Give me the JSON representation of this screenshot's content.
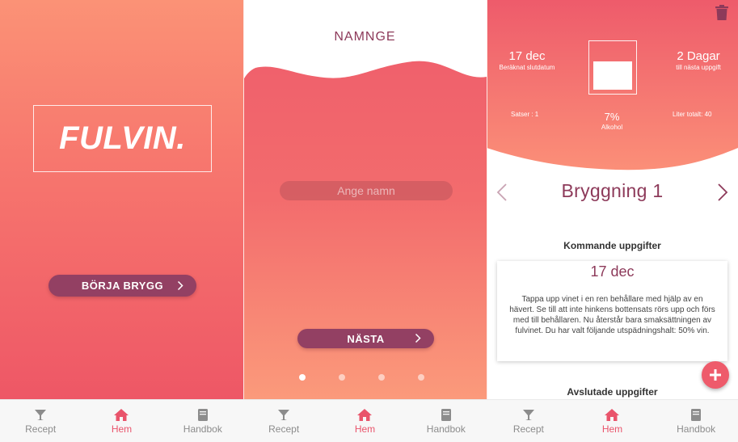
{
  "colors": {
    "accent": "#ee5b6b",
    "coral": "#fb9276",
    "plum": "#934063",
    "title_plum": "#8d3a5a",
    "nav_inactive": "#8c8c8c"
  },
  "bottom_nav": {
    "items": [
      {
        "label": "Recept",
        "icon": "funnel-glass-icon",
        "active": false
      },
      {
        "label": "Hem",
        "icon": "home-icon",
        "active": true
      },
      {
        "label": "Handbok",
        "icon": "book-icon",
        "active": false
      }
    ]
  },
  "screen1": {
    "logo": "FULVIN.",
    "start_button": "BÖRJA BRYGG"
  },
  "screen2": {
    "title": "NAMNGE",
    "name_placeholder": "Ange namn",
    "next_button": "NÄSTA",
    "pager": {
      "count": 4,
      "active_index": 0
    }
  },
  "screen3": {
    "end_date": {
      "value": "17 dec",
      "label": "Beräknat slutdatum"
    },
    "days_left": {
      "value": "2 Dagar",
      "label": "till nästa uppgift"
    },
    "batches": "Satser : 1",
    "alcohol": {
      "value": "7%",
      "label": "Alkohol"
    },
    "liters": "Liter totalt: 40",
    "glass_fill_fraction": 0.65,
    "brew_title": "Bryggning 1",
    "upcoming_title": "Kommande uppgifter",
    "task": {
      "date": "17 dec",
      "text": "Tappa upp vinet i en ren behållare med hjälp av en hävert. Se till att inte hinkens bottensats rörs upp och förs med till behållaren. Nu återstår bara smaksättningen av fulvinet. Du har valt följande utspädningshalt: 50% vin."
    },
    "completed_title": "Avslutade uppgifter"
  }
}
